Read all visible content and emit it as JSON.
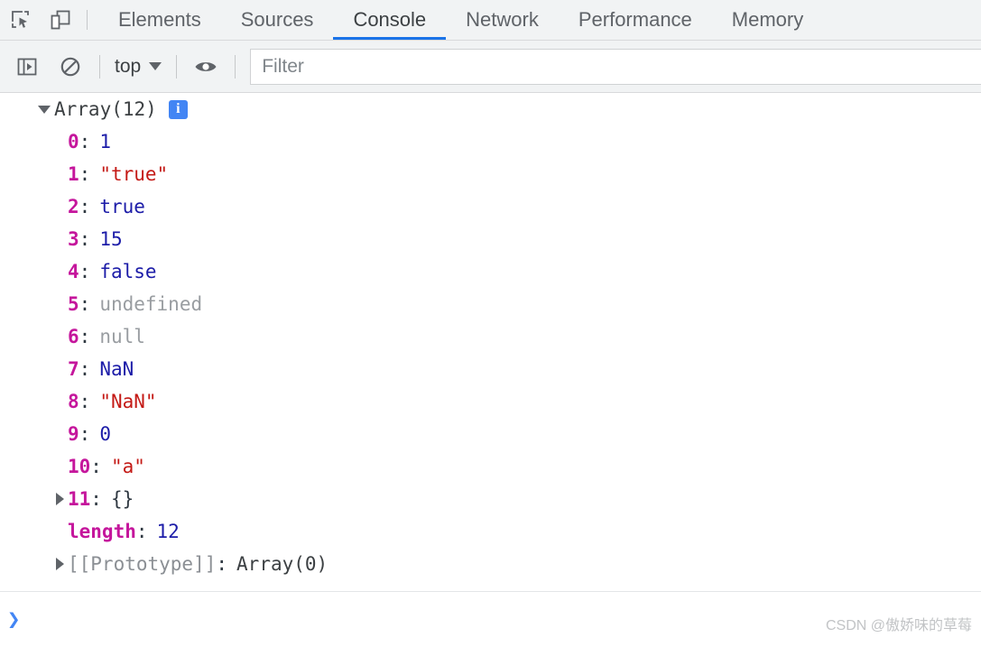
{
  "tabbar": {
    "icons": [
      {
        "name": "inspect-element-icon",
        "label": "Inspect element"
      },
      {
        "name": "device-toolbar-icon",
        "label": "Toggle device toolbar"
      }
    ],
    "tabs": [
      {
        "label": "Elements",
        "active": false
      },
      {
        "label": "Sources",
        "active": false
      },
      {
        "label": "Console",
        "active": true
      },
      {
        "label": "Network",
        "active": false
      },
      {
        "label": "Performance",
        "active": false
      },
      {
        "label": "Memory",
        "active": false
      }
    ],
    "active_tab": "Console",
    "accent_color": "#1a73e8",
    "background": "#f1f3f4"
  },
  "filterbar": {
    "sidebar_toggle_icon": "console-sidebar-icon",
    "clear_console_icon": "clear-console-icon",
    "context_selector": {
      "value": "top",
      "caret": "chevron-down-icon"
    },
    "eye_icon": "eye-icon",
    "filter": {
      "value": "",
      "placeholder": "Filter"
    }
  },
  "console": {
    "root": {
      "expanded": true,
      "label": "Array(12)",
      "info_badge": "i",
      "info_badge_color": "#4285f4"
    },
    "properties": [
      {
        "key": "0",
        "colon": ":",
        "value": "1",
        "type": "num",
        "expandable": false
      },
      {
        "key": "1",
        "colon": ":",
        "value": "\"true\"",
        "type": "str",
        "expandable": false
      },
      {
        "key": "2",
        "colon": ":",
        "value": "true",
        "type": "bool",
        "expandable": false
      },
      {
        "key": "3",
        "colon": ":",
        "value": "15",
        "type": "num",
        "expandable": false
      },
      {
        "key": "4",
        "colon": ":",
        "value": "false",
        "type": "bool",
        "expandable": false
      },
      {
        "key": "5",
        "colon": ":",
        "value": "undefined",
        "type": "null",
        "expandable": false
      },
      {
        "key": "6",
        "colon": ":",
        "value": "null",
        "type": "null",
        "expandable": false
      },
      {
        "key": "7",
        "colon": ":",
        "value": "NaN",
        "type": "num",
        "expandable": false
      },
      {
        "key": "8",
        "colon": ":",
        "value": "\"NaN\"",
        "type": "str",
        "expandable": false
      },
      {
        "key": "9",
        "colon": ":",
        "value": "0",
        "type": "num",
        "expandable": false
      },
      {
        "key": "10",
        "colon": ":",
        "value": "\"a\"",
        "type": "str",
        "expandable": false
      },
      {
        "key": "11",
        "colon": ":",
        "value": "{}",
        "type": "obj",
        "expandable": true
      },
      {
        "key": "length",
        "colon": ":",
        "value": "12",
        "type": "num",
        "expandable": false
      },
      {
        "key": "[[Prototype]]",
        "colon": ":",
        "value": "Array(0)",
        "type": "proto",
        "expandable": true
      }
    ],
    "colors": {
      "key": "#c5169c",
      "number": "#1c1ca8",
      "string": "#c41a16",
      "nullish": "#999da1",
      "object": "#303942"
    }
  },
  "prompt": {
    "chevron": "❯",
    "input_value": ""
  },
  "watermark": {
    "text": "CSDN @傲娇味的草莓"
  }
}
